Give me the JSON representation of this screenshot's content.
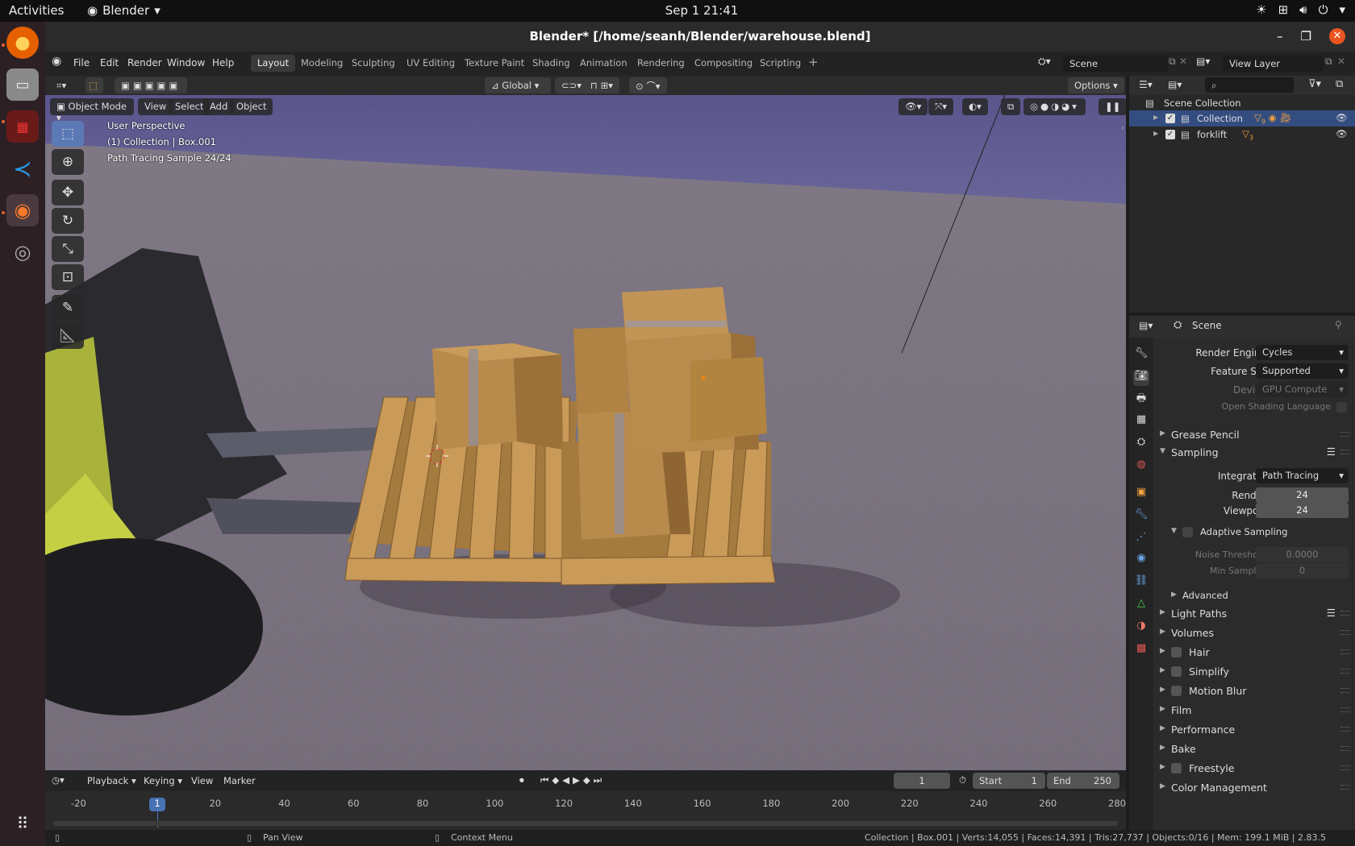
{
  "os": {
    "activities": "Activities",
    "app_name": "Blender",
    "clock": "Sep 1  21:41",
    "dock": [
      "firefox-icon",
      "files-icon",
      "terminal-icon",
      "vscode-icon",
      "blender-icon",
      "disc-icon",
      "app-grid-icon"
    ]
  },
  "window": {
    "title": "Blender* [/home/seanh/Blender/warehouse.blend]"
  },
  "menu": {
    "items": [
      "File",
      "Edit",
      "Render",
      "Window",
      "Help"
    ],
    "workspaces": [
      "Layout",
      "Modeling",
      "Sculpting",
      "UV Editing",
      "Texture Paint",
      "Shading",
      "Animation",
      "Rendering",
      "Compositing",
      "Scripting"
    ],
    "active_workspace": "Layout",
    "scene": "Scene",
    "view_layer": "View Layer"
  },
  "toolbar": {
    "transform_orientation": "Global",
    "options": "Options"
  },
  "viewport": {
    "mode": "Object Mode",
    "menus": [
      "View",
      "Select",
      "Add",
      "Object"
    ],
    "overlay_lines": [
      "User Perspective",
      "(1) Collection | Box.001",
      "Path Tracing Sample 24/24"
    ]
  },
  "timeline": {
    "menus": [
      "Playback",
      "Keying",
      "View",
      "Marker"
    ],
    "current_frame": "1",
    "start_label": "Start",
    "start": "1",
    "end_label": "End",
    "end": "250",
    "ticks": [
      "-20",
      "20",
      "40",
      "60",
      "80",
      "100",
      "120",
      "140",
      "160",
      "180",
      "200",
      "220",
      "240",
      "260",
      "280"
    ],
    "playhead": "1"
  },
  "status": {
    "pan": "Pan View",
    "context": "Context Menu",
    "info": "Collection | Box.001 | Verts:14,055 | Faces:14,391 | Tris:27,737 | Objects:0/16 | Mem: 199.1 MiB | 2.83.5"
  },
  "outliner": {
    "root": "Scene Collection",
    "rows": [
      {
        "name": "Collection",
        "badge": "9",
        "selected": true
      },
      {
        "name": "forklift",
        "badge": "3",
        "selected": false
      }
    ]
  },
  "properties": {
    "context": "Scene",
    "render_engine_label": "Render Engine",
    "render_engine": "Cycles",
    "feature_set_label": "Feature Set",
    "feature_set": "Supported",
    "device_label": "Device",
    "device": "GPU Compute",
    "osl_label": "Open Shading Language",
    "grease_pencil": "Grease Pencil",
    "sampling": "Sampling",
    "integrator_label": "Integrator",
    "integrator": "Path Tracing",
    "render_label": "Render",
    "render_samples": "24",
    "viewport_label": "Viewport",
    "viewport_samples": "24",
    "adaptive": "Adaptive Sampling",
    "noise_label": "Noise Threshold",
    "noise": "0.0000",
    "min_label": "Min Samples",
    "min": "0",
    "advanced": "Advanced",
    "light_paths": "Light Paths",
    "volumes": "Volumes",
    "hair": "Hair",
    "simplify": "Simplify",
    "motion_blur": "Motion Blur",
    "film": "Film",
    "performance": "Performance",
    "bake": "Bake",
    "freestyle": "Freestyle",
    "color_management": "Color Management"
  },
  "colors": {
    "accent": "#4772b3",
    "active_dock": "#e95420",
    "selection": "#334d80"
  }
}
